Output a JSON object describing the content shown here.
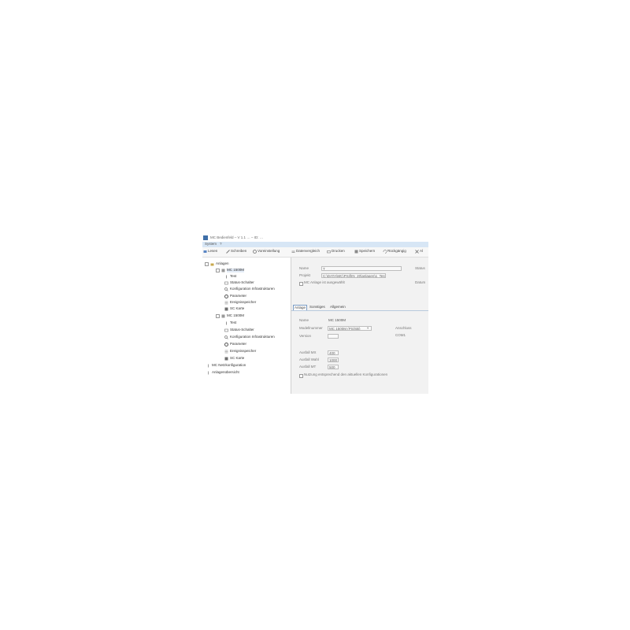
{
  "window": {
    "title": "MC Bedienfeld – V 1.1 … – ID: …"
  },
  "menu": {
    "items": [
      "System",
      "?"
    ]
  },
  "toolbar": {
    "items": [
      {
        "label": "Lesen",
        "icon": "read-icon"
      },
      {
        "label": "Schreiben",
        "icon": "pencil-icon"
      },
      {
        "label": "Voreinstellung",
        "icon": "gear-icon"
      },
      {
        "label": "Datenvergleich",
        "icon": "compare-icon"
      },
      {
        "label": "Drucken",
        "icon": "printer-icon"
      },
      {
        "label": "Speichern",
        "icon": "save-icon"
      },
      {
        "label": "Rückgängig",
        "icon": "undo-icon"
      },
      {
        "label": "Al",
        "icon": "close-icon"
      }
    ]
  },
  "tree": {
    "items": [
      {
        "label": "Anlagen",
        "icon": "folder-icon"
      },
      {
        "label": "MC 1500M",
        "icon": "controller-icon"
      },
      {
        "label": "Test",
        "icon": "test-icon"
      },
      {
        "label": "Status-Schalter",
        "icon": "switch-icon"
      },
      {
        "label": "Konfiguration Infrastrukturen",
        "icon": "search-config-icon"
      },
      {
        "label": "Parameter",
        "icon": "gear-icon"
      },
      {
        "label": "Ereignisspeicher",
        "icon": "list-icon"
      },
      {
        "label": "SC Karte",
        "icon": "card-icon"
      },
      {
        "label": "MC 1500M",
        "icon": "controller-icon"
      },
      {
        "label": "Test",
        "icon": "test-icon"
      },
      {
        "label": "Status-Schalter",
        "icon": "switch-icon"
      },
      {
        "label": "Konfiguration Infrastrukturen",
        "icon": "search-config-icon"
      },
      {
        "label": "Parameter",
        "icon": "gear-icon"
      },
      {
        "label": "Ereignisspeicher",
        "icon": "list-icon"
      },
      {
        "label": "SC Karte",
        "icon": "card-icon"
      },
      {
        "label": "MC Netzkonfiguration",
        "icon": "network-icon"
      },
      {
        "label": "Anlagenübersicht",
        "icon": "overview-icon"
      }
    ]
  },
  "details": {
    "name_label": "Name",
    "name_value": "T",
    "status_label": "Status",
    "project_label": "Projekt",
    "project_value": "C:\\DATA\\MC\\Prüf\\IN_20\\anlagen\\1_Test",
    "checkbox_label": "MC Anlage ist ausgewählt",
    "date_label": "Datum"
  },
  "tabs": [
    "Anlage",
    "Sonstiges",
    "Allgemein"
  ],
  "form": {
    "name_label": "Name",
    "name_value": "MC 1500M",
    "model_label": "Modellnummer",
    "model_value": "MC 1500M (PS/SB)",
    "version_label": "Version",
    "version_value": "",
    "side_label": "Anschluss",
    "side_value": "COM1",
    "r1_label": "Ausfall MX",
    "r1_value": "400",
    "r2_label": "Ausfall Wahl",
    "r2_value": "1000",
    "r3_label": "Ausfall MT",
    "r3_value": "500",
    "bottom_checkbox_label": "Nutzung entsprechend den aktuellen Konfigurationen"
  }
}
